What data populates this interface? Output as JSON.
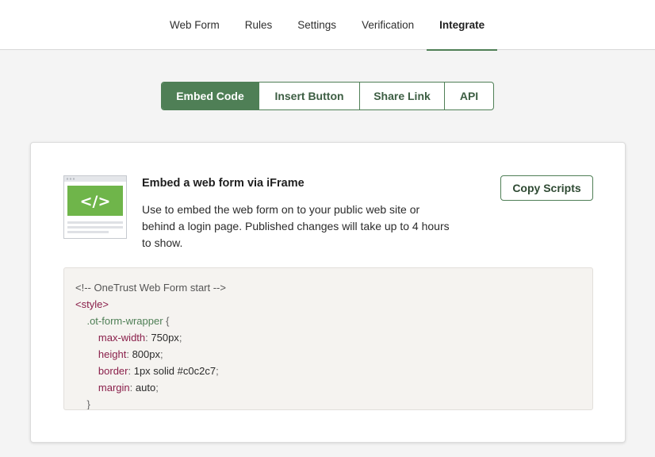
{
  "tabs": [
    {
      "label": "Web Form",
      "active": false
    },
    {
      "label": "Rules",
      "active": false
    },
    {
      "label": "Settings",
      "active": false
    },
    {
      "label": "Verification",
      "active": false
    },
    {
      "label": "Integrate",
      "active": true
    }
  ],
  "segments": [
    {
      "label": "Embed Code",
      "active": true
    },
    {
      "label": "Insert Button",
      "active": false
    },
    {
      "label": "Share Link",
      "active": false
    },
    {
      "label": "API",
      "active": false
    }
  ],
  "embed": {
    "title": "Embed a web form via iFrame",
    "description": "Use to embed the web form on to your public web site or behind a login page. Published changes will take up to 4 hours to show.",
    "copy_button": "Copy Scripts",
    "illustration_icon": "code-embed-icon",
    "illustration_glyph": "</>"
  },
  "code": {
    "comment": "<!-- OneTrust Web Form start -->",
    "style_open": "<style>",
    "selector": ".ot-form-wrapper",
    "brace_open": "{",
    "brace_close": "}",
    "props": [
      {
        "name": "max-width",
        "value": "750px"
      },
      {
        "name": "height",
        "value": "800px"
      },
      {
        "name": "border",
        "value": "1px solid #c0c2c7"
      },
      {
        "name": "margin",
        "value": "auto"
      }
    ]
  },
  "colors": {
    "accent": "#4f7f56",
    "illustration_green": "#6fb54a",
    "code_background": "#f5f3f0"
  }
}
